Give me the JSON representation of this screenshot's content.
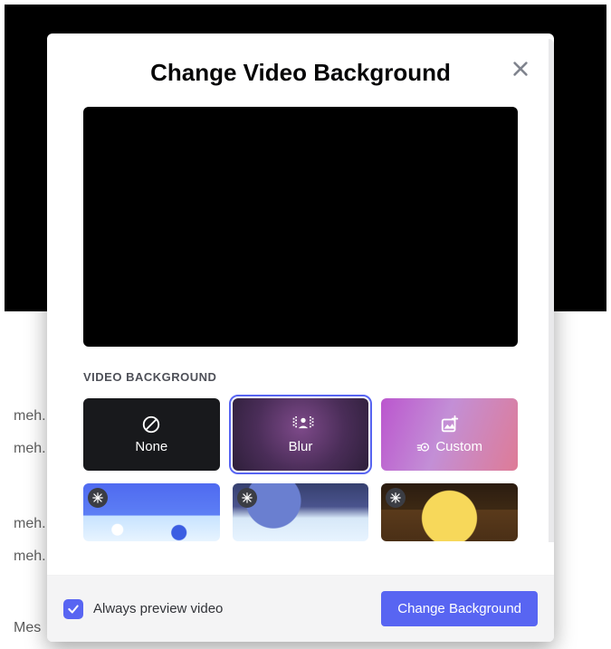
{
  "chat": {
    "messages": [
      "meh.",
      "meh.",
      "meh.",
      "meh."
    ],
    "input_prefix": "Mes"
  },
  "modal": {
    "title": "Change Video Background",
    "section_label": "VIDEO BACKGROUND",
    "options": {
      "none": "None",
      "blur": "Blur",
      "custom": "Custom"
    },
    "footer": {
      "checkbox_label": "Always preview video",
      "checkbox_checked": true,
      "confirm_label": "Change Background"
    }
  }
}
